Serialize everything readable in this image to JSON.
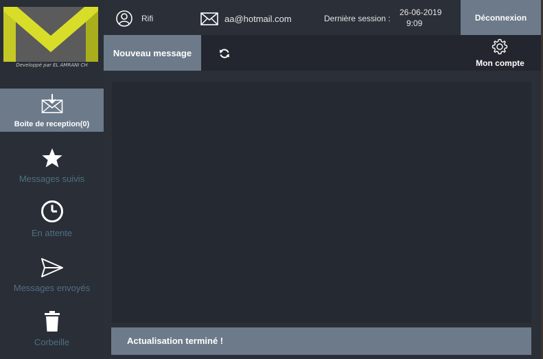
{
  "app": {
    "logo_caption": "Developpé par EL AMRANI CH"
  },
  "header": {
    "username": "Rifi",
    "email": "aa@hotmail.com",
    "last_session_label": "Dernière session :",
    "last_session_date": "26-06-2019",
    "last_session_time": "9:09",
    "logout_label": "Déconnexion"
  },
  "toolbar": {
    "new_message_label": "Nouveau message",
    "refresh_icon": "refresh-icon",
    "account_label": "Mon compte",
    "account_icon": "gear-icon"
  },
  "sidebar": {
    "items": [
      {
        "label": "Boite de reception(0)",
        "icon": "inbox-download-icon",
        "active": true
      },
      {
        "label": "Messages suivis",
        "icon": "star-icon",
        "active": false
      },
      {
        "label": "En attente",
        "icon": "clock-icon",
        "active": false
      },
      {
        "label": "Messages envoyés",
        "icon": "paper-plane-icon",
        "active": false
      },
      {
        "label": "Corbeille",
        "icon": "trash-icon",
        "active": false
      }
    ]
  },
  "status": {
    "text": "Actualisation terminé !"
  },
  "colors": {
    "accent": "#cbd42a",
    "button_bg": "#6c7a8a",
    "panel_bg": "#2b2f38",
    "inactive_label": "#4f6f85"
  }
}
